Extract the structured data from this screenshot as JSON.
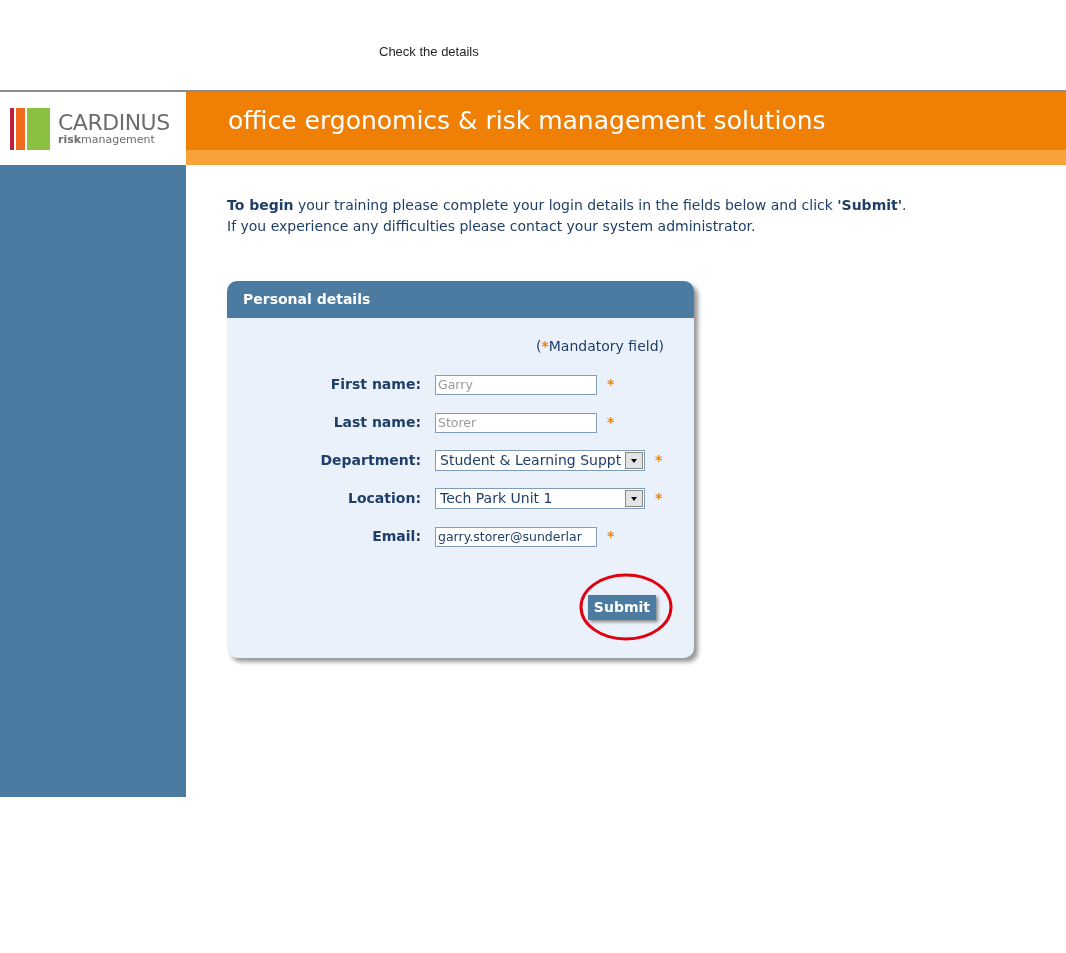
{
  "caption": "Check the details",
  "logo": {
    "name": "CARDINUS",
    "tagline": "**risk**management"
  },
  "banner": {
    "title": "office ergonomics & risk management solutions"
  },
  "intro": [
    "**To begin** your training please complete your login details in the fields below and click **'Submit'**.",
    "If you experience any difficulties please contact your system administrator."
  ],
  "panel": {
    "title": "Personal details",
    "note": {
      "prefix": "(",
      "marker": "*",
      "text": "Mandatory field)"
    },
    "fields": [
      {
        "kind": "text",
        "label": "First name:",
        "value": "Garry",
        "disabled": true,
        "marker": "*"
      },
      {
        "kind": "text",
        "label": "Last name:",
        "value": "Storer",
        "disabled": true,
        "marker": "*"
      },
      {
        "kind": "select",
        "label": "Department:",
        "value": "Student & Learning Suppt",
        "disabled": false,
        "marker": "*"
      },
      {
        "kind": "select",
        "label": "Location:",
        "value": "Tech Park Unit 1",
        "disabled": false,
        "marker": "*"
      },
      {
        "kind": "text",
        "label": "Email:",
        "value": "garry.storer@sunderlar",
        "disabled": false,
        "marker": "*"
      }
    ],
    "submit": {
      "label": "Submit",
      "highlighted": true
    }
  }
}
